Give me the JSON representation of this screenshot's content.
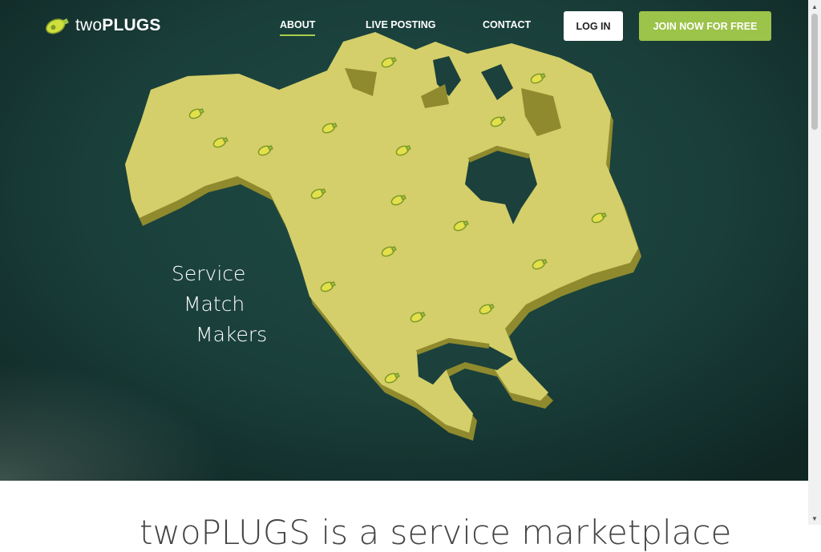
{
  "brand": {
    "name_light": "two",
    "name_bold": "PLUGS"
  },
  "nav": {
    "links": [
      {
        "label": "ABOUT",
        "active": true
      },
      {
        "label": "LIVE POSTING",
        "active": false
      },
      {
        "label": "CONTACT",
        "active": false
      }
    ],
    "login_label": "LOG IN",
    "join_label": "JOIN NOW FOR FREE"
  },
  "hero": {
    "tagline": [
      "Service",
      "Match",
      "Makers"
    ],
    "map_icon": "plug-icon"
  },
  "below": {
    "headline_partial": "twoPLUGS is a service marketplace"
  },
  "colors": {
    "accent": "#9cc34a",
    "map": "#d4cf6a",
    "map_edge": "#8f8a2e",
    "hero_bg": "#1e4641"
  }
}
